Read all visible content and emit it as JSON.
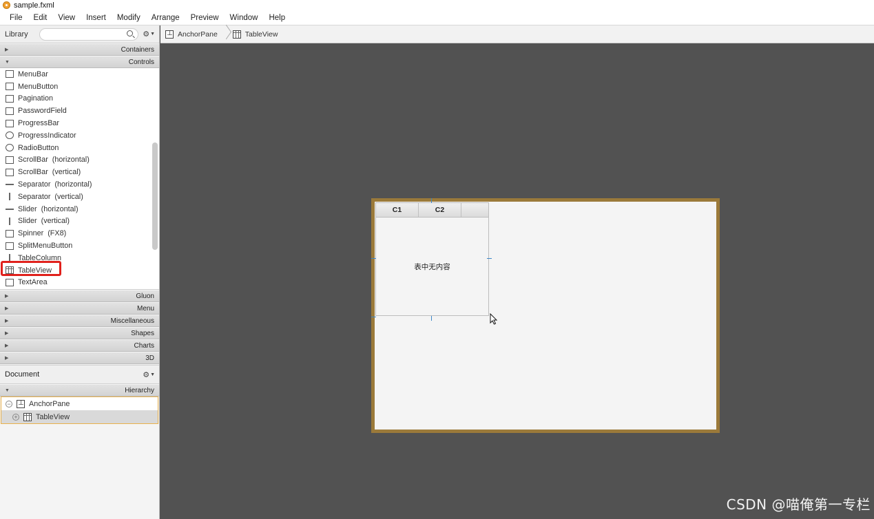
{
  "window": {
    "title": "sample.fxml"
  },
  "menubar": {
    "items": [
      "File",
      "Edit",
      "View",
      "Insert",
      "Modify",
      "Arrange",
      "Preview",
      "Window",
      "Help"
    ]
  },
  "library": {
    "title": "Library",
    "search_value": "",
    "sections_top": [
      "Containers",
      "Controls"
    ],
    "controls": [
      "MenuBar",
      "MenuButton",
      "Pagination",
      "PasswordField",
      "ProgressBar",
      "ProgressIndicator",
      "RadioButton",
      "ScrollBar  (horizontal)",
      "ScrollBar  (vertical)",
      "Separator  (horizontal)",
      "Separator  (vertical)",
      "Slider  (horizontal)",
      "Slider  (vertical)",
      "Spinner  (FX8)",
      "SplitMenuButton",
      "TableColumn",
      "TableView",
      "TextArea"
    ],
    "selected_control": "TableView",
    "sections_bottom": [
      "Gluon",
      "Menu",
      "Miscellaneous",
      "Shapes",
      "Charts",
      "3D"
    ]
  },
  "document": {
    "title": "Document",
    "section": "Hierarchy",
    "tree": [
      {
        "label": "AnchorPane",
        "toggle": "−"
      },
      {
        "label": "TableView",
        "toggle": "+"
      }
    ]
  },
  "breadcrumb": {
    "items": [
      "AnchorPane",
      "TableView"
    ]
  },
  "canvas": {
    "table": {
      "columns": [
        "C1",
        "C2"
      ],
      "placeholder": "表中无内容"
    }
  },
  "watermark": "CSDN @喵俺第一专栏"
}
